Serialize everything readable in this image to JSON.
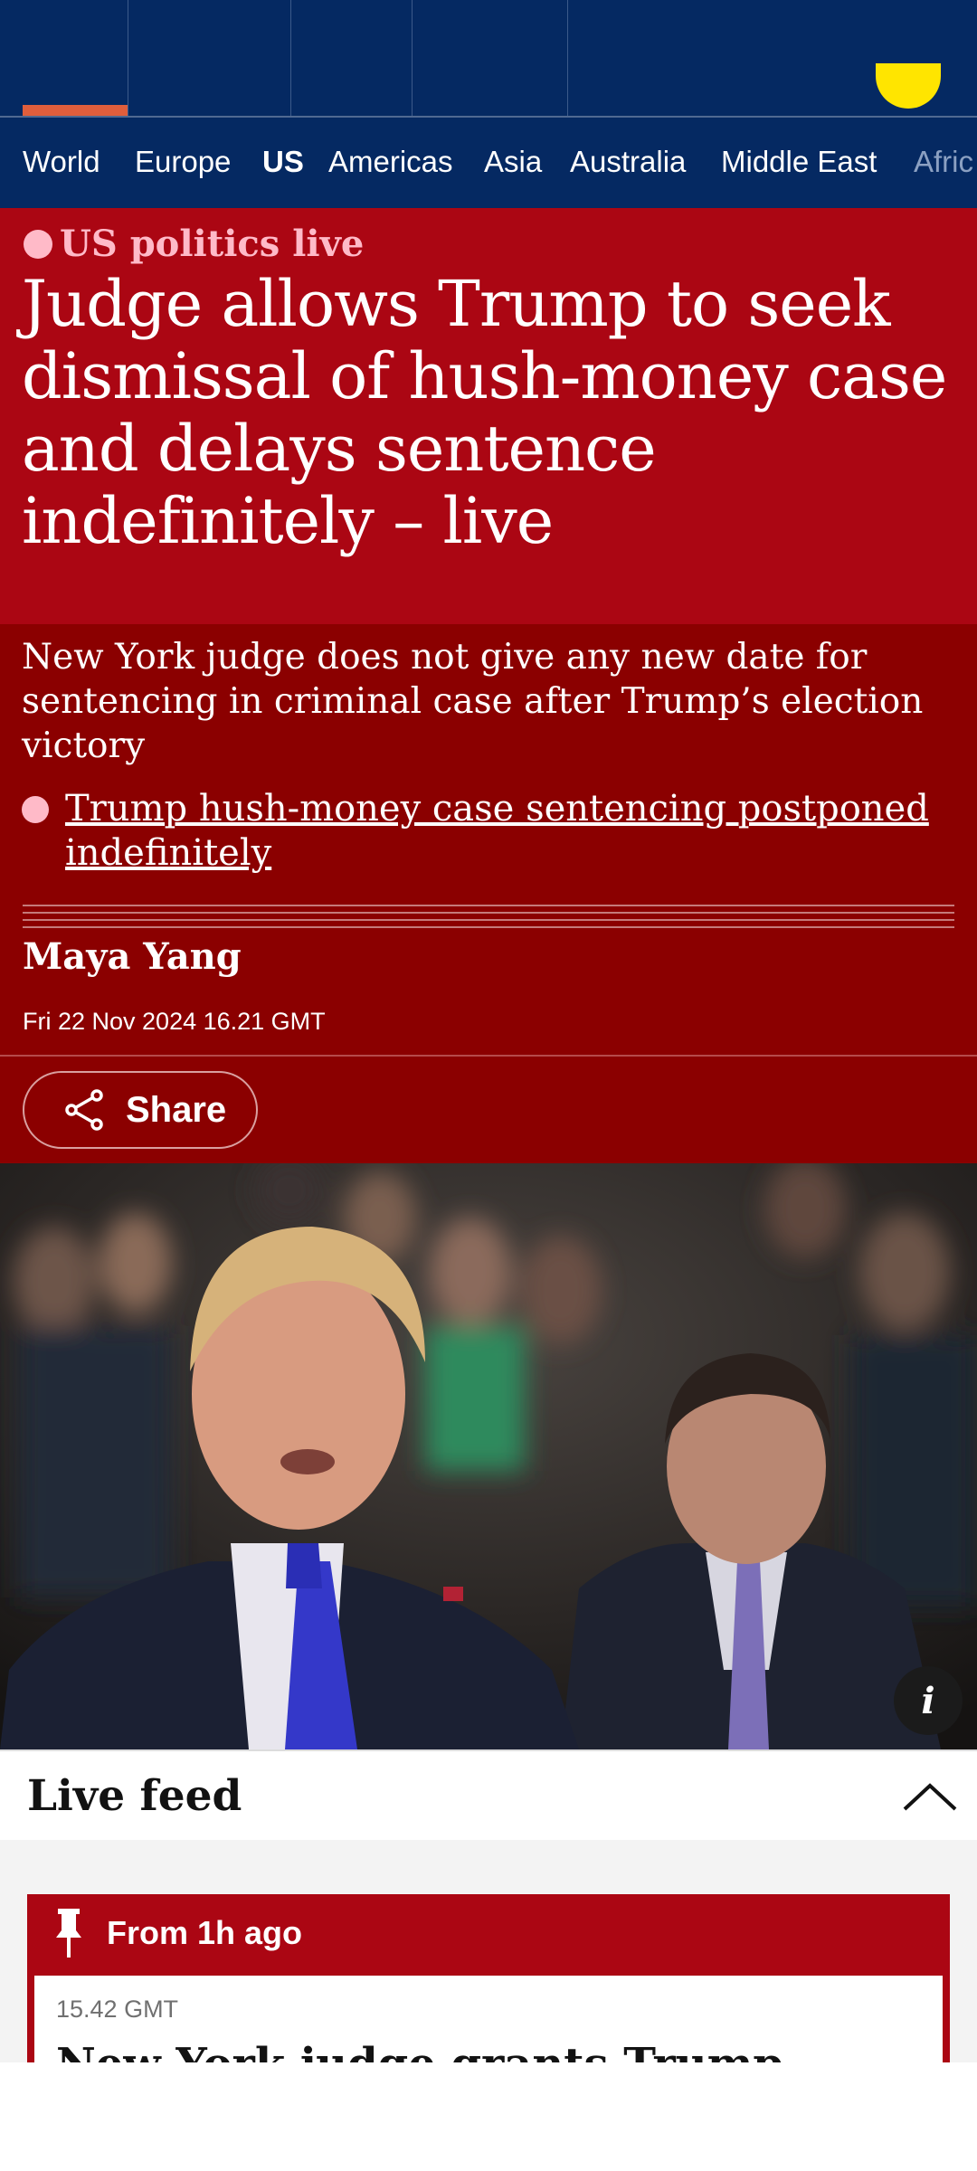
{
  "nav": {
    "items": [
      {
        "label": "World",
        "active": false
      },
      {
        "label": "Europe",
        "active": false
      },
      {
        "label": "US",
        "active": true
      },
      {
        "label": "Americas",
        "active": false
      },
      {
        "label": "Asia",
        "active": false
      },
      {
        "label": "Australia",
        "active": false
      },
      {
        "label": "Middle East",
        "active": false
      },
      {
        "label": "Afric",
        "active": false
      }
    ]
  },
  "article": {
    "kicker": "US politics live",
    "headline": "Judge allows Trump to seek dismissal of hush-money case and delays sentence indefinitely – live",
    "standfirst": "New York judge does not give any new date for sentencing in criminal case after Trump’s election victory",
    "related_link": "Trump hush-money case sentencing postponed indefinitely",
    "byline": "Maya Yang",
    "dateline": "Fri 22 Nov 2024 16.21 GMT",
    "share_label": "Share",
    "info_label": "i"
  },
  "live_feed": {
    "title": "Live feed",
    "pinned_label": "From 1h ago",
    "post_time": "15.42 GMT",
    "post_headline": "New York judge grants Trump"
  },
  "colors": {
    "masthead": "#052962",
    "live_red": "#ab0613",
    "standfirst_red": "#8b0000",
    "kicker_pink": "#ffbac8"
  }
}
